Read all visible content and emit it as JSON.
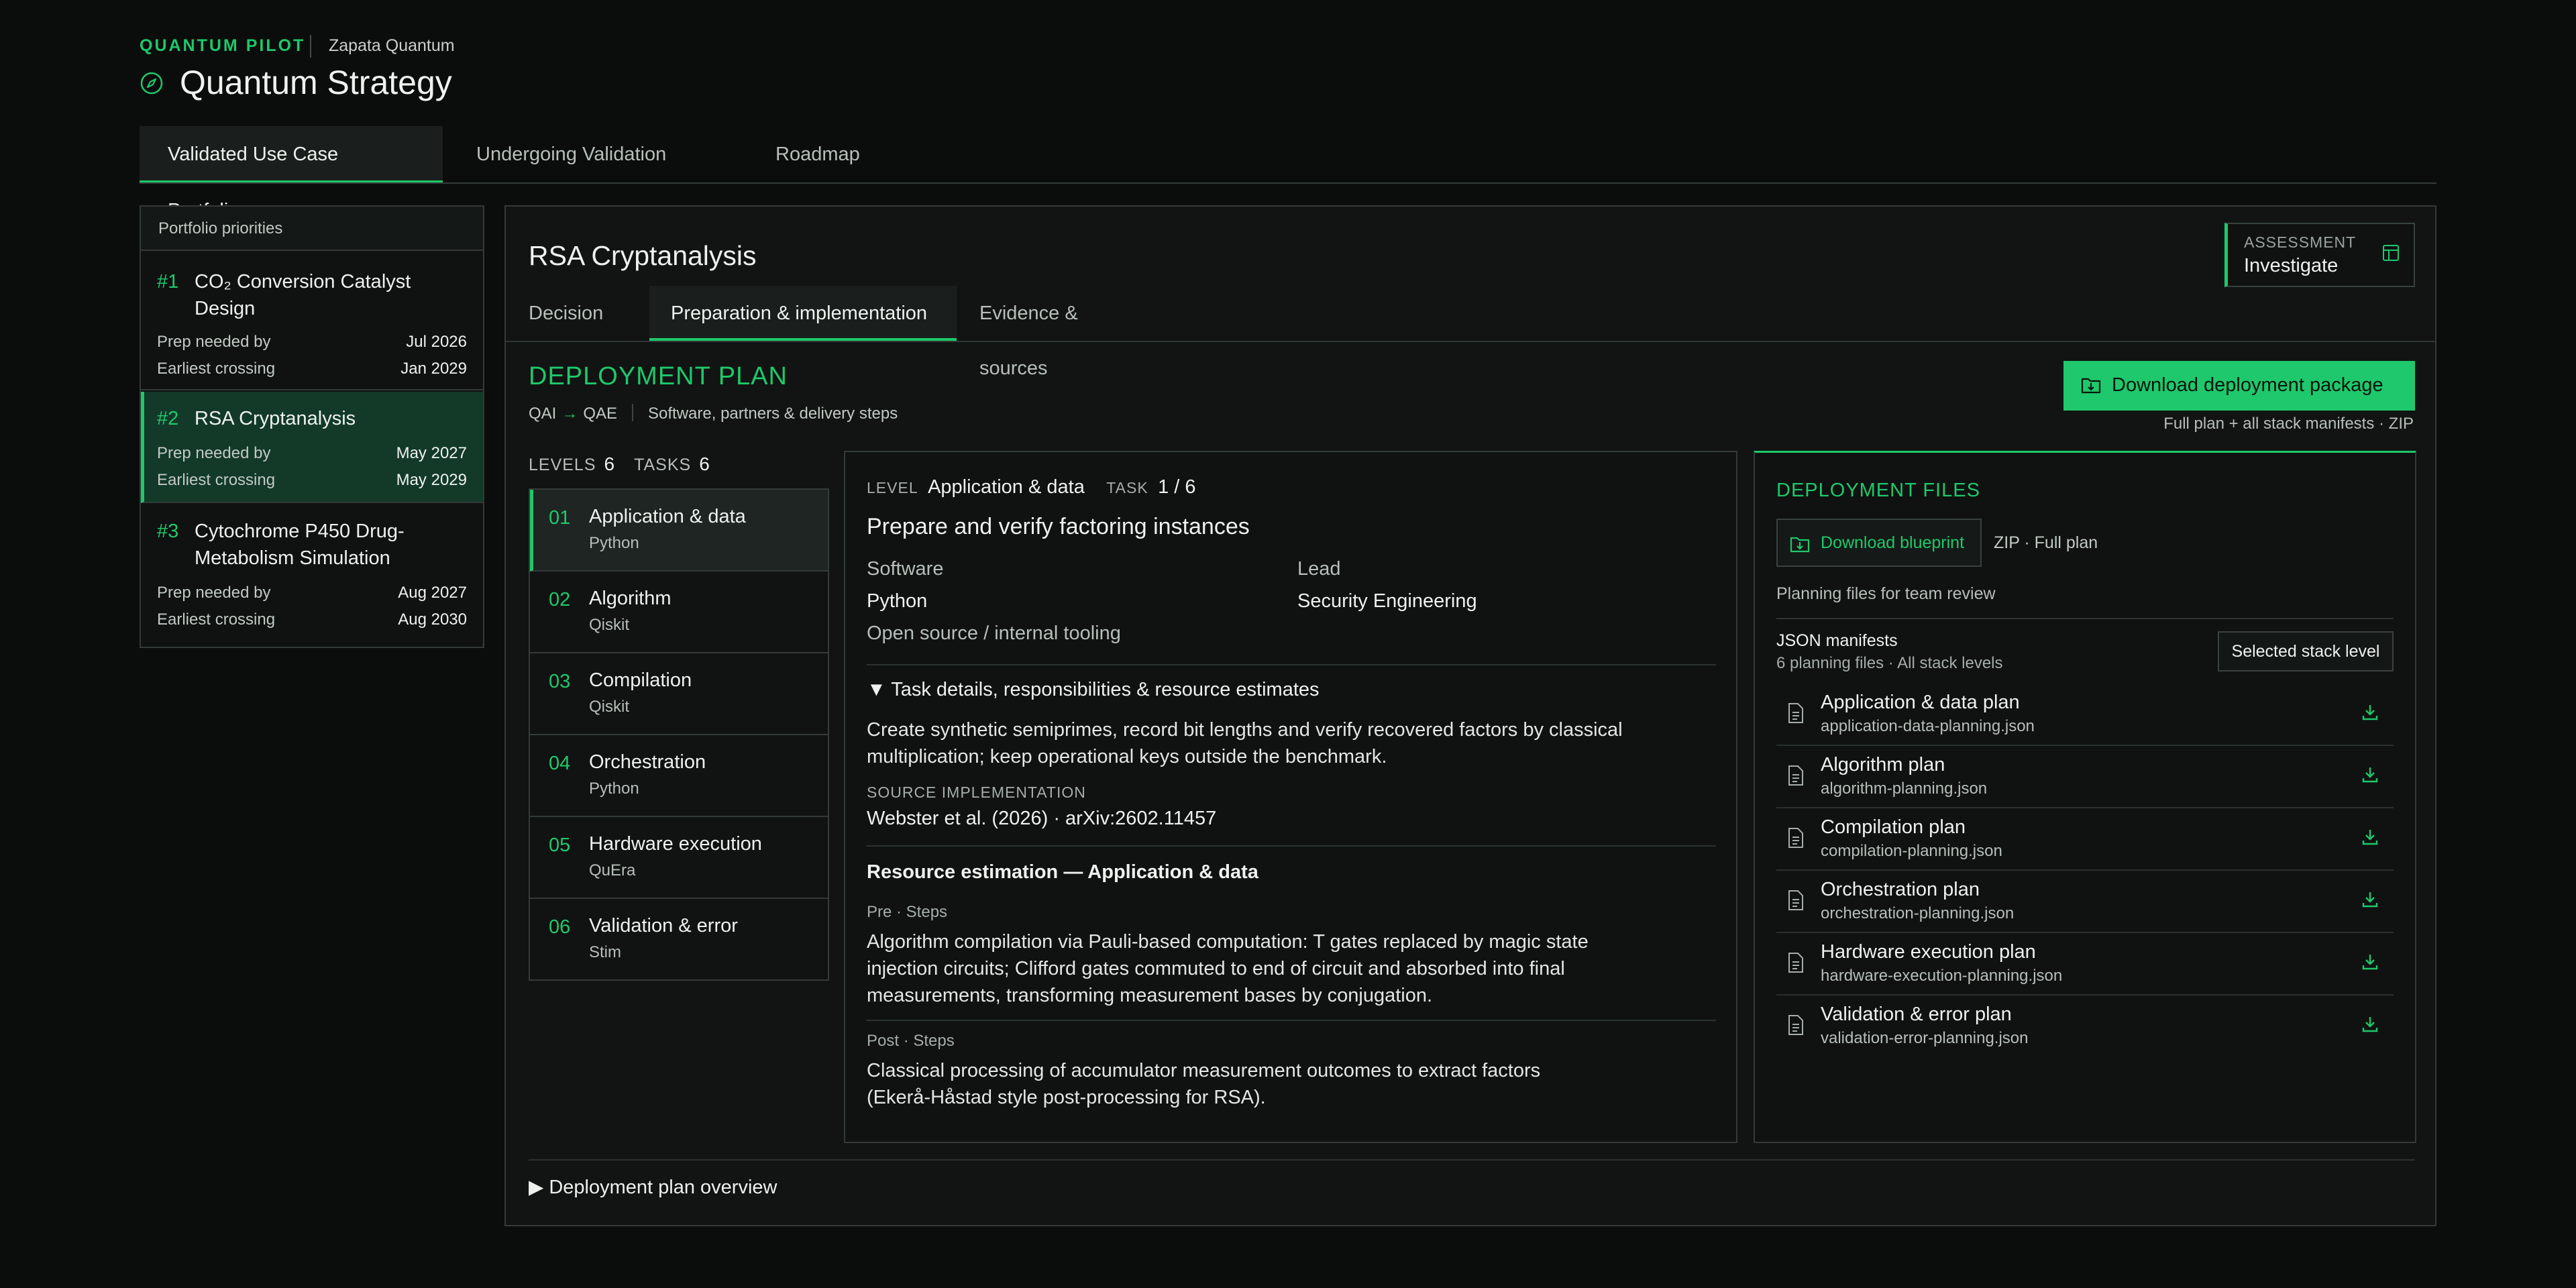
{
  "header": {
    "brand": "QUANTUM PILOT",
    "org": "Zapata Quantum",
    "title": "Quantum Strategy",
    "title_icon": "compass-icon"
  },
  "main_tabs": [
    {
      "label": "Validated Use Case Portfolio",
      "active": true
    },
    {
      "label": "Undergoing Validation",
      "active": false
    },
    {
      "label": "Roadmap",
      "active": false
    }
  ],
  "portfolio": {
    "header": "Portfolio priorities",
    "prep_label": "Prep needed by",
    "crossing_label": "Earliest crossing",
    "items": [
      {
        "rank": "#1",
        "name": "CO₂ Conversion Catalyst Design",
        "prep": "Jul 2026",
        "crossing": "Jan 2029",
        "active": false
      },
      {
        "rank": "#2",
        "name": "RSA Cryptanalysis",
        "prep": "May 2027",
        "crossing": "May 2029",
        "active": true
      },
      {
        "rank": "#3",
        "name": "Cytochrome P450 Drug-Metabolism Simulation",
        "prep": "Aug 2027",
        "crossing": "Aug 2030",
        "active": false
      }
    ]
  },
  "content": {
    "title": "RSA Cryptanalysis",
    "assessment_label": "ASSESSMENT",
    "assessment_value": "Investigate",
    "sub_tabs": [
      {
        "label": "Decision",
        "active": false
      },
      {
        "label": "Preparation & implementation",
        "active": true
      },
      {
        "label": "Evidence & sources",
        "active": false
      }
    ],
    "plan_title": "DEPLOYMENT PLAN",
    "plan_from": "QAI",
    "plan_to": "QAE",
    "plan_desc": "Software, partners & delivery steps",
    "download_package": "Download deployment package",
    "download_package_note": "Full plan + all stack manifests · ZIP",
    "levels_label": "LEVELS",
    "levels_count": "6",
    "tasks_label": "TASKS",
    "tasks_count": "6",
    "levels": [
      {
        "n": "01",
        "title": "Application & data",
        "sub": "Python",
        "active": true
      },
      {
        "n": "02",
        "title": "Algorithm",
        "sub": "Qiskit",
        "active": false
      },
      {
        "n": "03",
        "title": "Compilation",
        "sub": "Qiskit",
        "active": false
      },
      {
        "n": "04",
        "title": "Orchestration",
        "sub": "Python",
        "active": false
      },
      {
        "n": "05",
        "title": "Hardware execution",
        "sub": "QuEra",
        "active": false
      },
      {
        "n": "06",
        "title": "Validation & error",
        "sub": "Stim",
        "active": false
      }
    ],
    "overview_label": "▶ Deployment plan overview"
  },
  "task": {
    "level_label": "LEVEL",
    "level_value": "Application & data",
    "task_label": "TASK",
    "task_value": "1 / 6",
    "title": "Prepare and verify factoring instances",
    "software_label": "Software",
    "software_value": "Python",
    "software_note": "Open source / internal tooling",
    "lead_label": "Lead",
    "lead_value": "Security Engineering",
    "details_toggle": "▼ Task details, responsibilities & resource estimates",
    "details_text": "Create synthetic semiprimes, record bit lengths and verify recovered factors by classical multiplication; keep operational keys outside the benchmark.",
    "source_label": "SOURCE IMPLEMENTATION",
    "source_value": "Webster et al. (2026) · arXiv:2602.11457",
    "resource_title": "Resource estimation — Application & data",
    "pre_label": "Pre · Steps",
    "pre_text": "Algorithm compilation via Pauli‑based computation: T gates replaced by magic state injection circuits; Clifford gates commuted to end of circuit and absorbed into final measurements, transforming measurement bases by conjugation.",
    "post_label": "Post · Steps",
    "post_text": "Classical processing of accumulator measurement outcomes to extract factors (Ekerå‑Håstad style post‑processing for RSA)."
  },
  "files": {
    "title": "DEPLOYMENT FILES",
    "download_blueprint": "Download blueprint",
    "zip_note": "ZIP · Full plan",
    "planning_note": "Planning files for team review",
    "json_title": "JSON manifests",
    "json_sub": "6 planning files · All stack levels",
    "selected_button": "Selected stack level",
    "items": [
      {
        "name": "Application & data plan",
        "file": "application-data-planning.json"
      },
      {
        "name": "Algorithm plan",
        "file": "algorithm-planning.json"
      },
      {
        "name": "Compilation plan",
        "file": "compilation-planning.json"
      },
      {
        "name": "Orchestration plan",
        "file": "orchestration-planning.json"
      },
      {
        "name": "Hardware execution plan",
        "file": "hardware-execution-planning.json"
      },
      {
        "name": "Validation & error plan",
        "file": "validation-error-planning.json"
      }
    ]
  },
  "colors": {
    "accent": "#1fc86c",
    "background": "#0b0d0c",
    "panel": "#111413"
  }
}
